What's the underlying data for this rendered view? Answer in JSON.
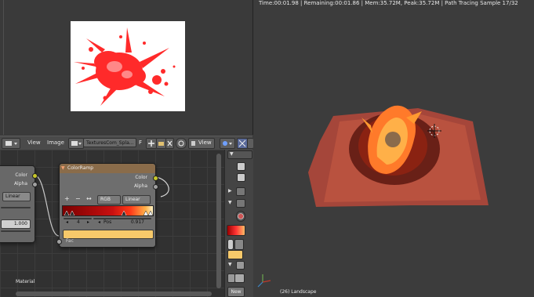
{
  "image_editor": {
    "header": {
      "view_menu": "View",
      "image_menu": "Image",
      "image_name": "TexturesCom_Spla...",
      "f_label": "F",
      "view_menu_2": "View"
    }
  },
  "node_editor": {
    "left_node": {
      "out_color": "Color",
      "out_alpha": "Alpha",
      "interpolation": "Linear",
      "value": "1.000"
    },
    "color_ramp": {
      "title": "ColorRamp",
      "out_color": "Color",
      "out_alpha": "Alpha",
      "add_label": "+",
      "remove_label": "−",
      "flip_label": "↔",
      "color_mode": "RGB",
      "interpolation": "Linear",
      "active_index": "4",
      "pos_label": "Pos",
      "pos_value": "0.917",
      "input_label": "Fac",
      "swatch_color": "#f7c96a"
    },
    "footer_label": "Material"
  },
  "side_panel": {
    "new_button": "New"
  },
  "viewport": {
    "status": "Time:00:01.98 | Remaining:00:01.86 | Mem:35.72M, Peak:35.72M | Path Tracing Sample 17/32",
    "object_label": "(26) Landscape"
  },
  "colors": {
    "splash_red": "#ff2a2a",
    "terrain": "#b0473a",
    "lava": "#ff9a30",
    "node_header": "#8a6c4a",
    "socket_yellow": "#c7c729"
  }
}
